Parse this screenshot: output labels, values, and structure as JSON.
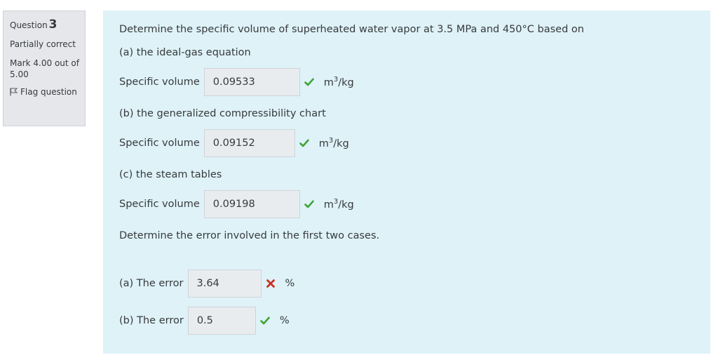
{
  "info": {
    "question_prefix": "Question",
    "question_number": "3",
    "state": "Partially correct",
    "grade": "Mark 4.00 out of 5.00",
    "flag_label": "Flag question"
  },
  "question": {
    "text": "Determine the specific volume of superheated water vapor at 3.5 MPa and 450°C based on",
    "part_a": "(a) the ideal-gas equation",
    "part_b": "(b) the generalized compressibility chart",
    "part_c": "(c) the steam tables",
    "error_prompt": "Determine the error involved in the first two cases.",
    "sv_label": "Specific volume",
    "unit_base": "m",
    "unit_exp": "3",
    "unit_tail": "/kg",
    "percent": "%",
    "answers": {
      "a_value": "0.09533",
      "b_value": "0.09152",
      "c_value": "0.09198",
      "err_a_label": "(a) The error",
      "err_a_value": "3.64",
      "err_b_label": "(b) The error",
      "err_b_value": "0.5"
    },
    "colors": {
      "correct": "#3fa535",
      "incorrect": "#ca3120"
    }
  }
}
